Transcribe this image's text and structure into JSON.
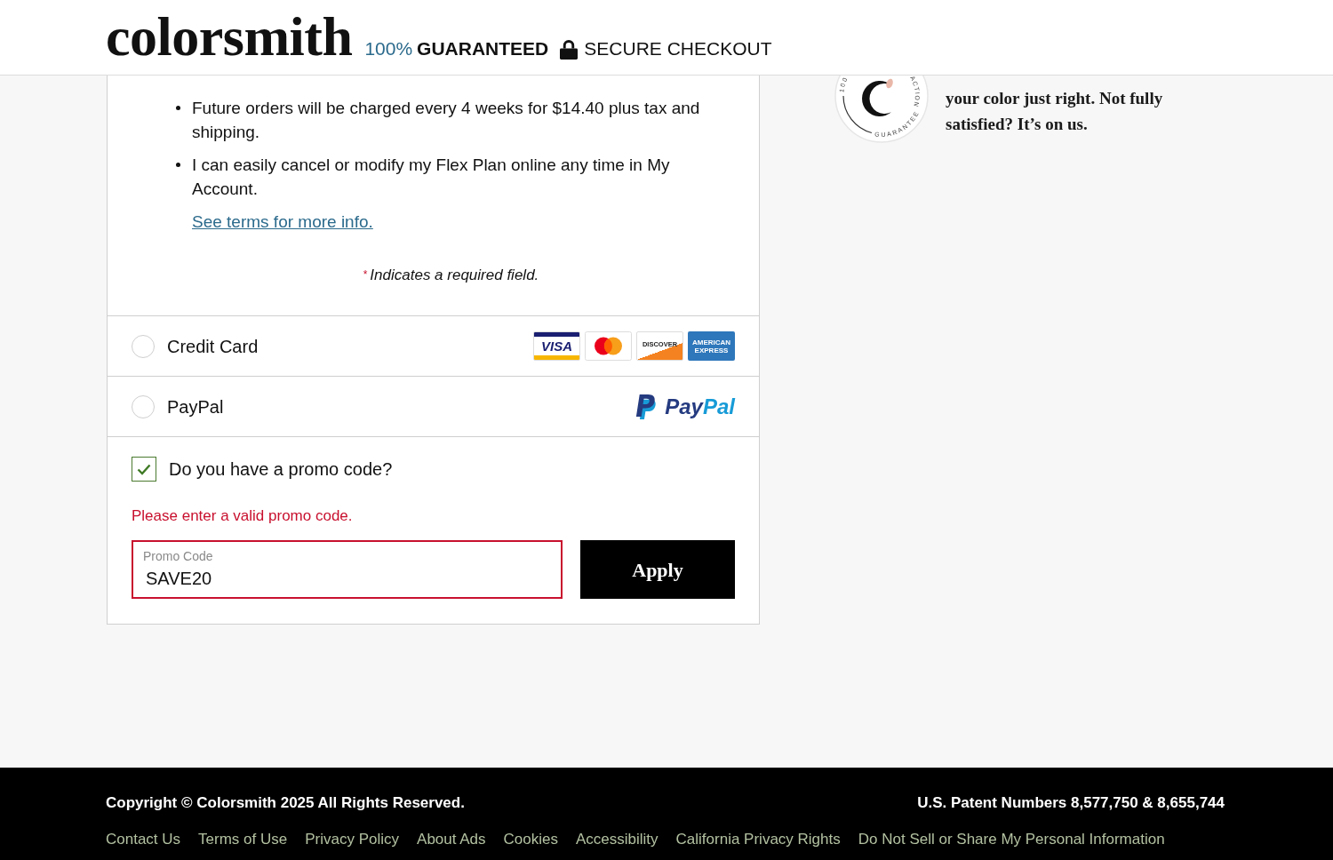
{
  "header": {
    "logo": "colorsmith",
    "guarantee_percent": "100%",
    "guarantee_label": "GUARANTEED",
    "secure_label": "SECURE CHECKOUT"
  },
  "flex_plan": {
    "terms": [
      "Future orders will be charged every 4 weeks for $14.40 plus tax and shipping.",
      "I can easily cancel or modify my Flex Plan online any time in My Account."
    ],
    "terms_link": "See terms for more info.",
    "required_mark": "*",
    "required_note": "Indicates a required field."
  },
  "payment_methods": [
    {
      "label": "Credit Card",
      "selected": false,
      "logos": [
        {
          "kind": "visa",
          "text": "VISA"
        },
        {
          "kind": "mastercard"
        },
        {
          "kind": "discover",
          "text": "DISCOVER"
        },
        {
          "kind": "amex",
          "text": "AMERICAN EXPRESS"
        }
      ]
    },
    {
      "label": "PayPal",
      "selected": false,
      "logos": [
        {
          "kind": "paypal",
          "text": "PayPal"
        }
      ]
    }
  ],
  "promo": {
    "question": "Do you have a promo code?",
    "checked": true,
    "error": "Please enter a valid promo code.",
    "field": {
      "label": "Promo Code",
      "value": "SAVE20",
      "invalid": true
    },
    "button": "Apply"
  },
  "guarantee_aside": {
    "seal_texts": [
      "100",
      "ACTION",
      "GUARANTEE"
    ],
    "text": "your color just right. Not fully satisfied? It’s on us."
  },
  "footer": {
    "copyright": "Copyright © Colorsmith 2025 All Rights Reserved.",
    "patent": "U.S. Patent Numbers 8,577,750 & 8,655,744",
    "links": [
      "Contact Us",
      "Terms of Use",
      "Privacy Policy",
      "About Ads",
      "Cookies",
      "Accessibility",
      "California Privacy Rights",
      "Do Not Sell or Share My Personal Information"
    ]
  }
}
